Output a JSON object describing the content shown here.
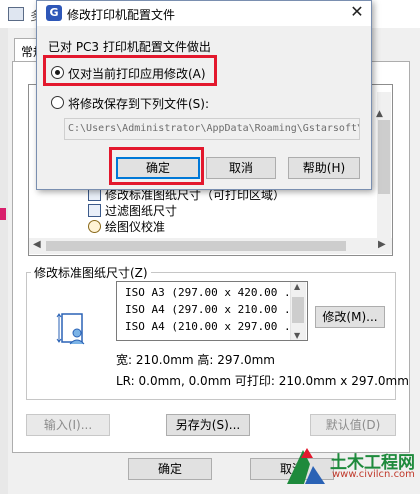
{
  "colors": {
    "highlight": "#e3182d",
    "accent_focus": "#0078d7",
    "watermark_green": "#1e8a3c",
    "watermark_red": "#c0392b"
  },
  "icons": {
    "bg_app_icon": "printer-settings-icon",
    "modal_app_icon": "gstarsoft-g-icon",
    "close": "close-icon",
    "tree_item": "document-icon",
    "tree_calibrate": "compass-icon",
    "paper_size": "paper-size-icon",
    "watermark": "watermark-logo-icon"
  },
  "background_dialog": {
    "title_fragment": "多",
    "tab_label": "常规",
    "tree": {
      "items": [
        {
          "label": "修改标准图纸尺寸（可打印区域）"
        },
        {
          "label": "过滤图纸尺寸"
        },
        {
          "label": "绘图仪校准"
        }
      ]
    },
    "group": {
      "label": "修改标准图纸尺寸(Z)",
      "sizes": [
        "ISO A3 (297.00 x 420.00 ...",
        "ISO A4 (297.00 x 210.00 ...",
        "ISO A4 (210.00 x 297.00 ..."
      ],
      "modify_button": "修改(M)...",
      "dimensions_line": "宽: 210.0mm  高: 297.0mm",
      "margins_line": "LR: 0.0mm, 0.0mm  可打印: 210.0mm x 297.0mm"
    },
    "buttons": {
      "import": "输入(I)...",
      "save_as": "另存为(S)...",
      "default": "默认值(D)",
      "ok": "确定",
      "cancel": "取消"
    }
  },
  "modal": {
    "title": "修改打印机配置文件",
    "close_glyph": "✕",
    "heading": "已对 PC3 打印机配置文件做出",
    "options": [
      {
        "label": "仅对当前打印应用修改(A)",
        "selected": true
      },
      {
        "label": "将修改保存到下列文件(S):",
        "selected": false
      }
    ],
    "file_path": "C:\\Users\\Administrator\\AppData\\Roaming\\Gstarsoft\\",
    "buttons": {
      "ok": "确定",
      "cancel": "取消",
      "help": "帮助(H)"
    }
  },
  "watermark": {
    "name": "土木工程网",
    "url": "www.civilcn.com"
  }
}
